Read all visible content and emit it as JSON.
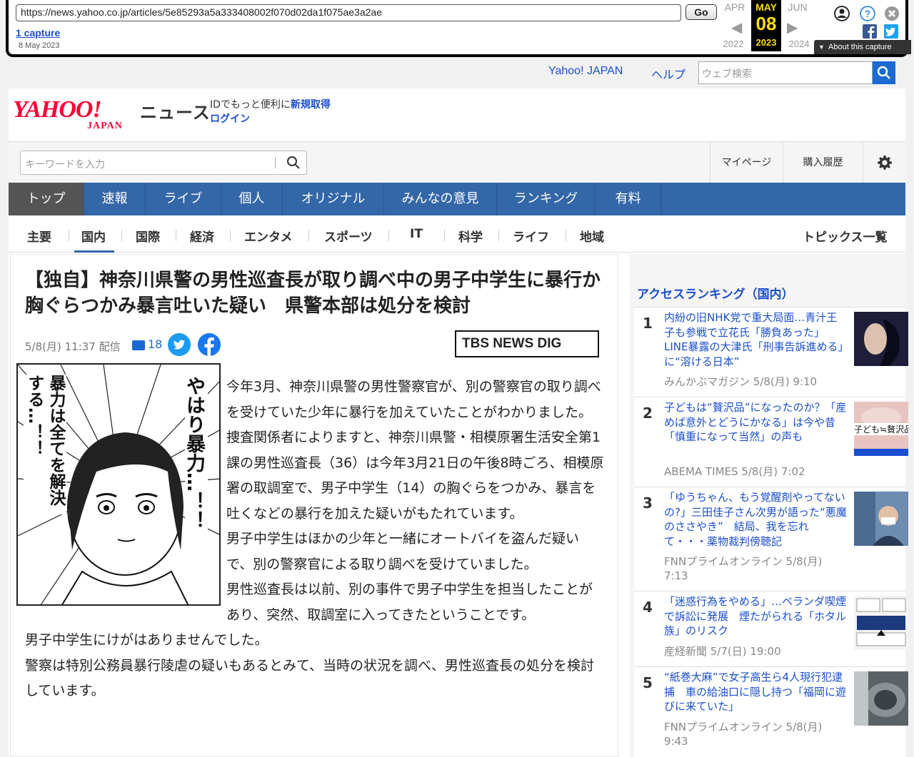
{
  "wayback": {
    "url": "https://news.yahoo.co.jp/articles/5e85293a5a333408002f070d02da1f075ae3a2ae",
    "go_label": "Go",
    "captures": "1 capture",
    "capture_date": "8 May 2023",
    "months": {
      "prev": "APR",
      "current": "MAY",
      "next": "JUN"
    },
    "day": "08",
    "years": {
      "prev": "2022",
      "current": "2023",
      "next": "2024"
    },
    "about": "About this capture"
  },
  "top": {
    "yahoo_japan": "Yahoo! JAPAN",
    "help": "ヘルプ",
    "web_search_placeholder": "ウェブ検索"
  },
  "header": {
    "news_label": "ニュース",
    "id_text": "IDでもっと便利に",
    "register": "新規取得",
    "login": "ログイン"
  },
  "search": {
    "placeholder": "キーワードを入力",
    "mypage": "マイページ",
    "history": "購入履歴"
  },
  "gnav": [
    "トップ",
    "速報",
    "ライブ",
    "個人",
    "オリジナル",
    "みんなの意見",
    "ランキング",
    "有料"
  ],
  "subnav": [
    "主要",
    "国内",
    "国際",
    "経済",
    "エンタメ",
    "スポーツ",
    "IT",
    "科学",
    "ライフ",
    "地域"
  ],
  "topics_all": "トピックス一覧",
  "article": {
    "headline": "【独自】神奈川県警の男性巡査長が取り調べ中の男子中学生に暴行か　胸ぐらつかみ暴言吐いた疑い　県警本部は処分を検討",
    "datetime": "5/8(月) 11:37 配信",
    "comments": "18",
    "source_logo": "TBS NEWS DIG",
    "manga_text_1": "やはり暴力…！！",
    "manga_text_2": "暴力は全てを解決する…！！",
    "paragraphs": [
      "今年3月、神奈川県警の男性警察官が、別の警察官の取り調べを受けていた少年に暴行を加えていたことがわかりました。",
      "捜査関係者によりますと、神奈川県警・相模原署生活安全第1課の男性巡査長（36）は今年3月21日の午後8時ごろ、相模原署の取調室で、男子中学生（14）の胸ぐらをつかみ、暴言を吐くなどの暴行を加えた疑いがもたれています。",
      "男子中学生はほかの少年と一緒にオートバイを盗んだ疑いで、別の警察官による取り調べを受けていました。",
      "男性巡査長は以前、別の事件で男子中学生を担当したことがあり、突然、取調室に入ってきたということです。",
      "男子中学生にけがはありませんでした。",
      "警察は特別公務員暴行陵虐の疑いもあるとみて、当時の状況を調べ、男性巡査長の処分を検討しています。"
    ]
  },
  "ranking": {
    "title": "アクセスランキング（国内）",
    "items": [
      {
        "num": "1",
        "title": "内紛の旧NHK党で重大局面…青汁王子も参戦で立花氏「勝負あった」LINE暴露の大津氏「刑事告訴進める」に“溶ける日本”",
        "source": "みんかぶマガジン 5/8(月) 9:10"
      },
      {
        "num": "2",
        "title": "子どもは“贅沢品”になったのか？「産めば意外とどうにかなる」は今や昔「慎重になって当然」の声も",
        "source": "ABEMA TIMES 5/8(月) 7:02",
        "thumb_text": "子ども≒贅沢品"
      },
      {
        "num": "3",
        "title": "「ゆうちゃん、もう覚醒剤やってないの?」三田佳子さん次男が語った“悪魔のささやき”　結局、我を忘れて・・・薬物裁判傍聴記",
        "source": "FNNプライムオンライン 5/8(月) 7:13"
      },
      {
        "num": "4",
        "title": "「迷惑行為をやめる」…ベランダ喫煙で訴訟に発展　煙たがられる「ホタル族」のリスク",
        "source": "産経新聞 5/7(日) 19:00"
      },
      {
        "num": "5",
        "title": "“紙巻大麻”で女子高生ら4人現行犯逮捕　車の給油口に隠し持つ「福岡に遊びに来ていた」",
        "source": "FNNプライムオンライン 5/8(月) 9:43"
      }
    ]
  },
  "colors": {
    "brand_red": "#ff0033",
    "nav_blue": "#3467a8",
    "link_blue": "#1a4ed0",
    "wayback_yellow": "#ffde00"
  }
}
